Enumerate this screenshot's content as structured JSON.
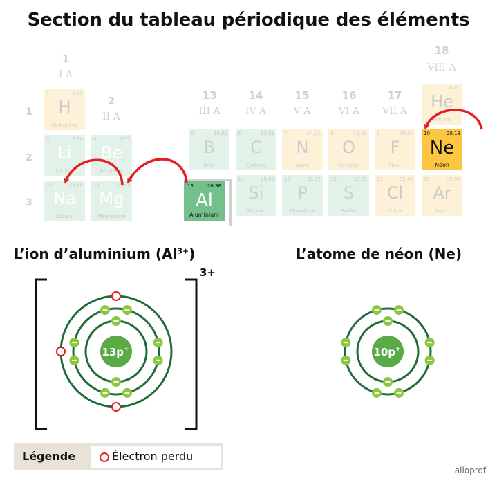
{
  "title": "Section du tableau périodique des éléments",
  "groups": [
    {
      "num": "1",
      "roman": "I A"
    },
    {
      "num": "2",
      "roman": "II A"
    },
    {
      "num": "13",
      "roman": "III A"
    },
    {
      "num": "14",
      "roman": "IV A"
    },
    {
      "num": "15",
      "roman": "V A"
    },
    {
      "num": "16",
      "roman": "VI A"
    },
    {
      "num": "17",
      "roman": "VII A"
    },
    {
      "num": "18",
      "roman": "VIII A"
    }
  ],
  "periods": [
    "1",
    "2",
    "3"
  ],
  "elements": {
    "H": {
      "number": "1",
      "mass": "1,01",
      "symbol": "H",
      "name": "Hydrogène"
    },
    "He": {
      "number": "2",
      "mass": "4,00",
      "symbol": "He",
      "name": "Hélium"
    },
    "Li": {
      "number": "3",
      "mass": "6,94",
      "symbol": "Li",
      "name": "Lithium"
    },
    "Be": {
      "number": "4",
      "mass": "9,01",
      "symbol": "Be",
      "name": "Béryllium"
    },
    "B": {
      "number": "5",
      "mass": "10,81",
      "symbol": "B",
      "name": "Bore"
    },
    "C": {
      "number": "6",
      "mass": "12,01",
      "symbol": "C",
      "name": "Carbone"
    },
    "N": {
      "number": "7",
      "mass": "14,01",
      "symbol": "N",
      "name": "Azote"
    },
    "O": {
      "number": "8",
      "mass": "16,00",
      "symbol": "O",
      "name": "Oxygène"
    },
    "F": {
      "number": "9",
      "mass": "19,00",
      "symbol": "F",
      "name": "Fluor"
    },
    "Ne": {
      "number": "10",
      "mass": "20,18",
      "symbol": "Ne",
      "name": "Néon"
    },
    "Na": {
      "number": "11",
      "mass": "22,99",
      "symbol": "Na",
      "name": "Sodium"
    },
    "Mg": {
      "number": "12",
      "mass": "24,31",
      "symbol": "Mg",
      "name": "Magnésium"
    },
    "Al": {
      "number": "13",
      "mass": "26,98",
      "symbol": "Al",
      "name": "Aluminium"
    },
    "Si": {
      "number": "14",
      "mass": "28,09",
      "symbol": "Si",
      "name": "Silicium"
    },
    "P": {
      "number": "15",
      "mass": "30,97",
      "symbol": "P",
      "name": "Phosphore"
    },
    "S": {
      "number": "16",
      "mass": "32,07",
      "symbol": "S",
      "name": "Soufre"
    },
    "Cl": {
      "number": "17",
      "mass": "35,45",
      "symbol": "Cl",
      "name": "Chlore"
    },
    "Ar": {
      "number": "18",
      "mass": "39,95",
      "symbol": "Ar",
      "name": "Argon"
    }
  },
  "ion_diagram": {
    "heading": "L’ion d’aluminium (Al",
    "heading_sup": "3+",
    "heading_end": ")",
    "charge": "3+",
    "nucleus": "13p",
    "nucleus_sup": "+",
    "shells": [
      2,
      8,
      3
    ],
    "lost_electrons": 3
  },
  "atom_diagram": {
    "heading": "L’atome de néon (Ne)",
    "nucleus": "10p",
    "nucleus_sup": "+",
    "shells": [
      2,
      8
    ]
  },
  "legend": {
    "label": "Légende",
    "item": "Électron perdu"
  },
  "brand": "alloprof",
  "colors": {
    "arrow": "#e31e24",
    "orbit": "#1f6b3a",
    "electron": "#8dc63f",
    "nucleus": "#5aaa46",
    "aluminium": "#74c08c",
    "neon": "#fdc641"
  }
}
